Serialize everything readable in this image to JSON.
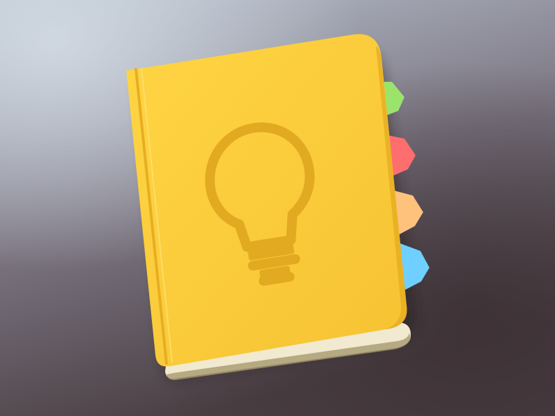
{
  "artwork": {
    "subject": "notebook-app-icon",
    "emblem": "lightbulb-icon"
  },
  "colors": {
    "background_top": "#b9c3cf",
    "background_mid": "#7a7480",
    "background_bottom": "#4a3f43",
    "cover_light": "#ffd544",
    "cover_dark": "#f6c232",
    "cover_edge": "#e3a91d",
    "spine_line": "#e8ae22",
    "emblem": "#e2aa20",
    "pages": "#f1ead0",
    "page_shadow": "#a89a6f",
    "tab_green": "#9be36b",
    "tab_red": "#ff6e6e",
    "tab_orange": "#ffc27c",
    "tab_blue": "#6fd0ff"
  },
  "tabs": [
    {
      "name": "green",
      "color_key": "tab_green"
    },
    {
      "name": "red",
      "color_key": "tab_red"
    },
    {
      "name": "orange",
      "color_key": "tab_orange"
    },
    {
      "name": "blue",
      "color_key": "tab_blue"
    }
  ]
}
